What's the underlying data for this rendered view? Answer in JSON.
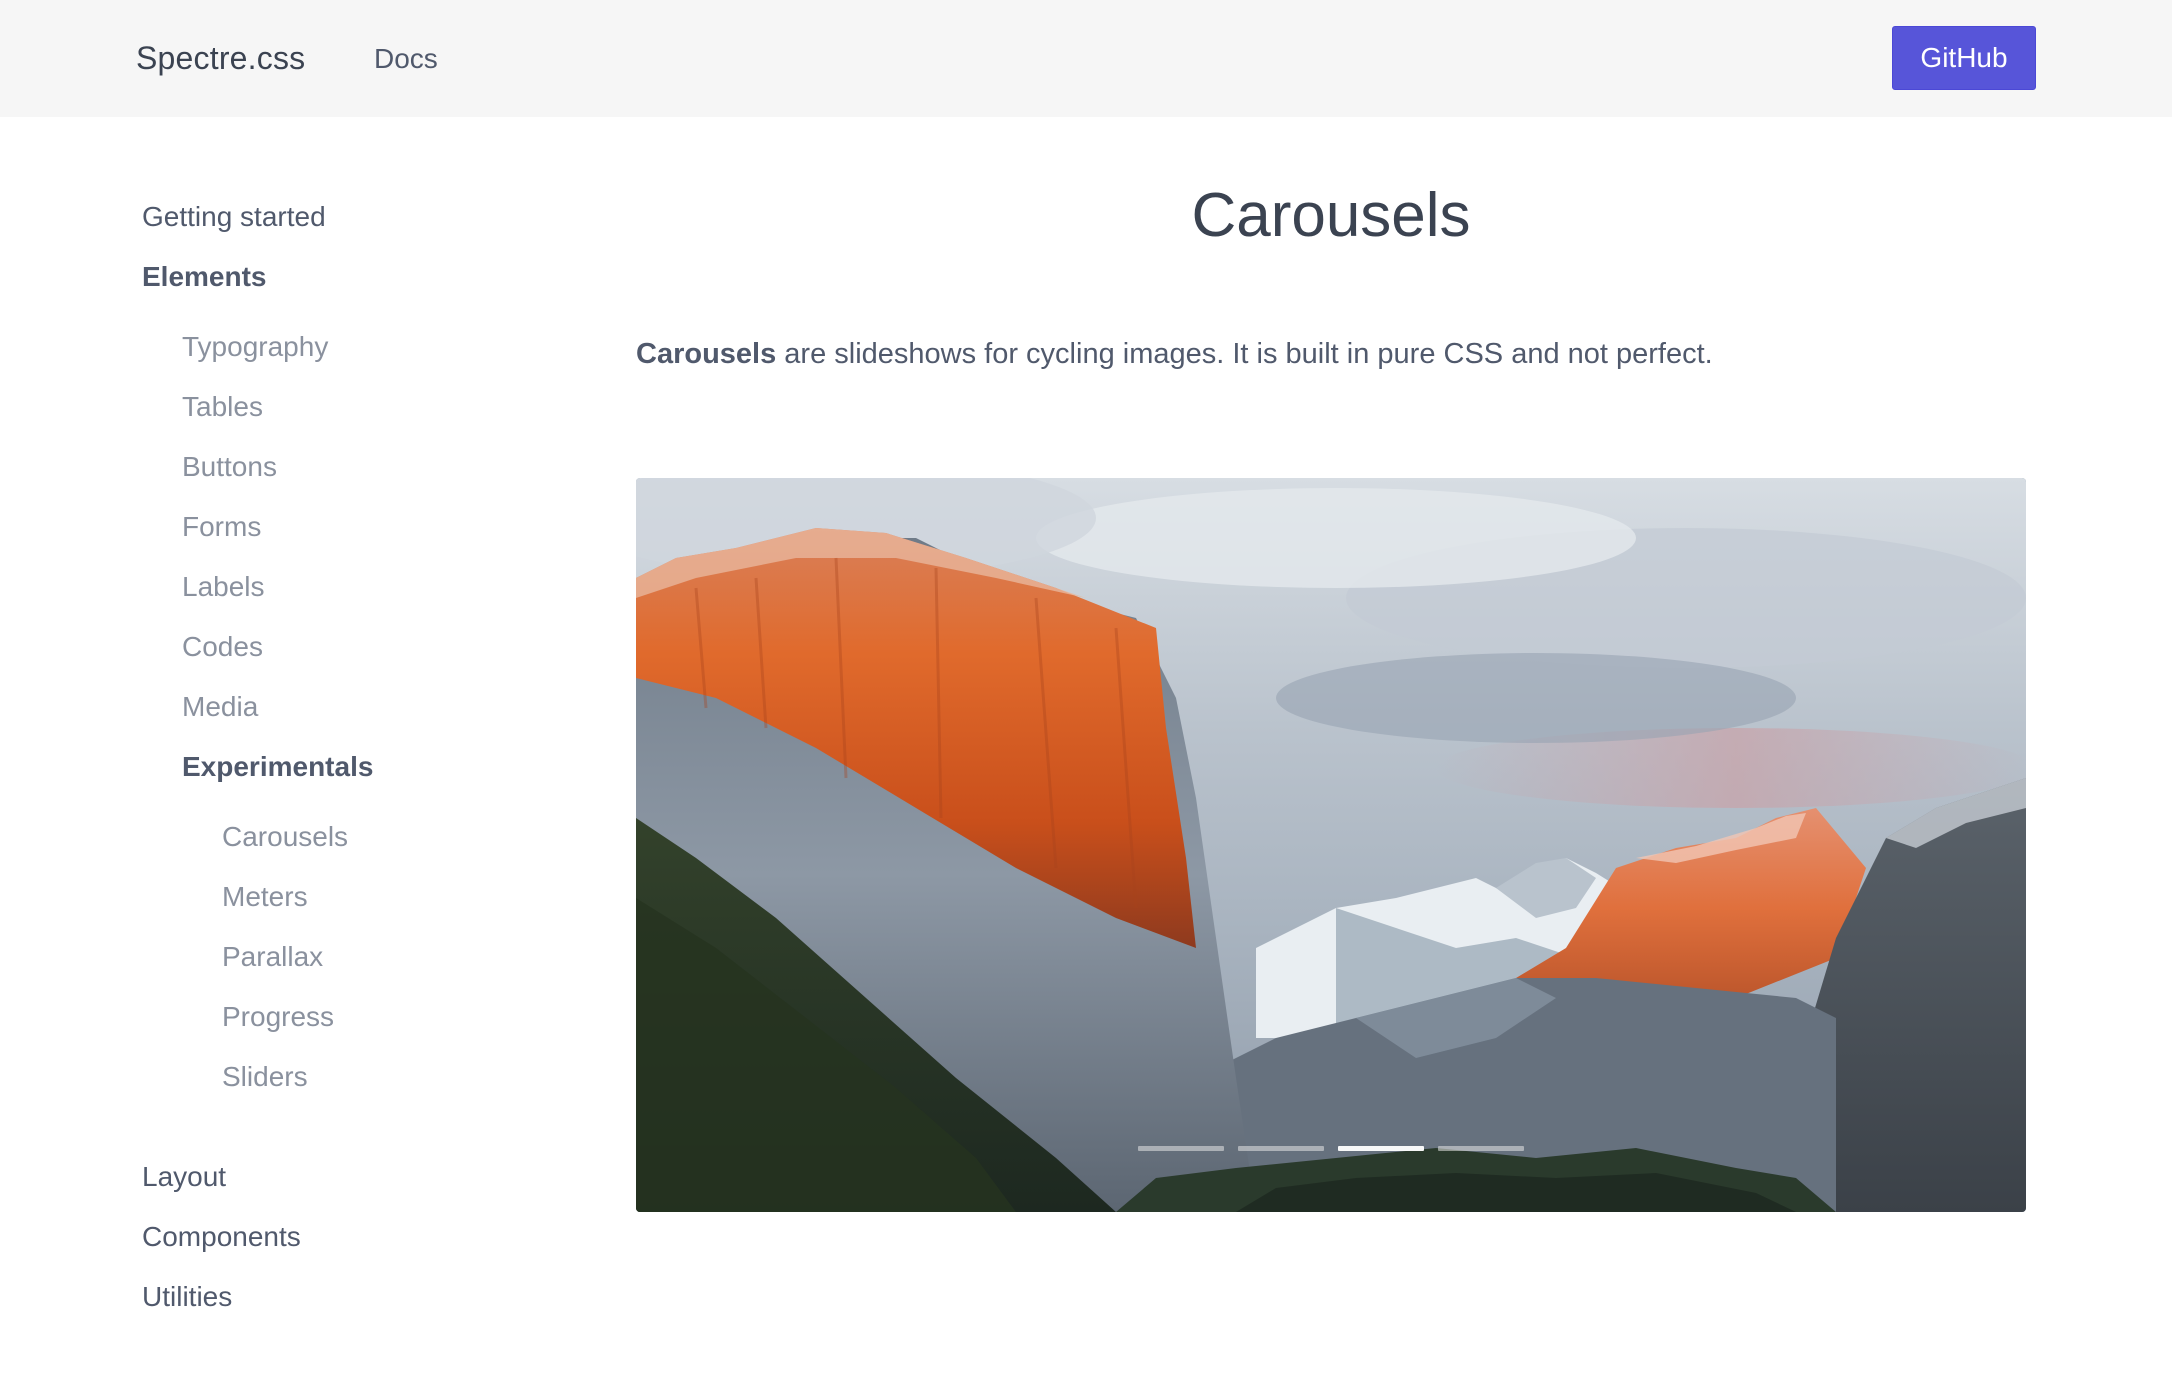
{
  "navbar": {
    "brand": "Spectre.css",
    "docs_link": "Docs",
    "github_button": "GitHub"
  },
  "sidebar": {
    "top_items": [
      "Getting started",
      "Elements"
    ],
    "elements_items": [
      "Typography",
      "Tables",
      "Buttons",
      "Forms",
      "Labels",
      "Codes",
      "Media",
      "Experimentals"
    ],
    "experimentals_items": [
      "Carousels",
      "Meters",
      "Parallax",
      "Progress",
      "Sliders"
    ],
    "bottom_items": [
      "Layout",
      "Components",
      "Utilities"
    ]
  },
  "main": {
    "title": "Carousels",
    "intro_strong": "Carousels",
    "intro_rest": " are slideshows for cycling images. It is built in pure CSS and not perfect."
  },
  "carousel": {
    "slide_count": 4,
    "active_slide": 3
  },
  "colors": {
    "navbar_bg": "#f6f6f6",
    "primary": "#5755d9",
    "text": "#50596c",
    "muted_text": "#8a919e"
  }
}
